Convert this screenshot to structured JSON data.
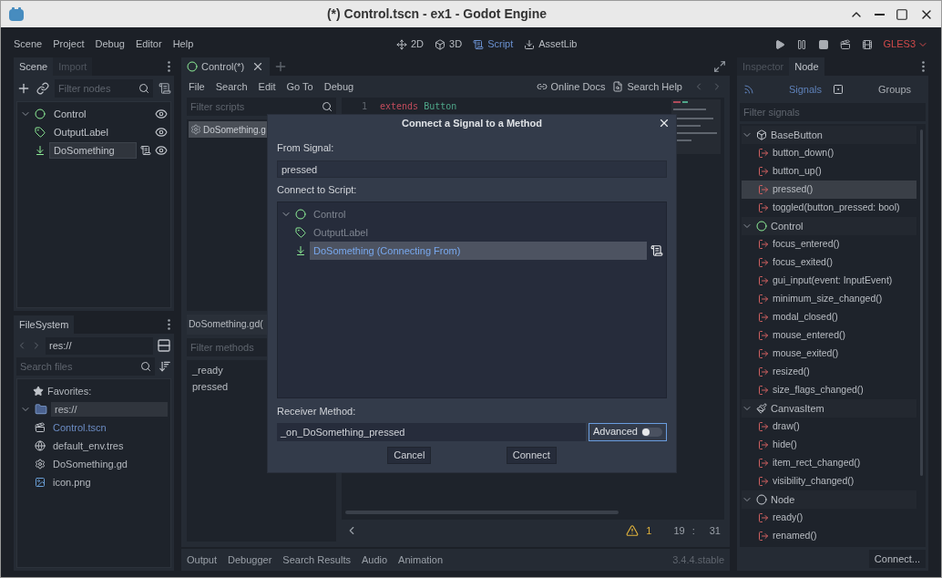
{
  "window": {
    "title": "(*) Control.tscn - ex1 - Godot Engine"
  },
  "menu": [
    "Scene",
    "Project",
    "Debug",
    "Editor",
    "Help"
  ],
  "workspaces": [
    {
      "label": "2D",
      "kind": "flat",
      "selected": false
    },
    {
      "label": "3D",
      "kind": "spatial",
      "selected": false
    },
    {
      "label": "Script",
      "kind": "script",
      "selected": true
    },
    {
      "label": "AssetLib",
      "kind": "assetlib",
      "selected": false
    }
  ],
  "renderer": "GLES3",
  "scene_dock": {
    "tabs": [
      {
        "label": "Scene",
        "selected": true
      },
      {
        "label": "Import",
        "selected": false
      }
    ],
    "filter_placeholder": "Filter nodes",
    "tree": [
      {
        "name": "Control",
        "kind": "control",
        "selected": false,
        "script": false,
        "children": [
          {
            "name": "OutputLabel",
            "kind": "label",
            "selected": false,
            "script": false
          },
          {
            "name": "DoSomething",
            "kind": "button",
            "selected": true,
            "script": true
          }
        ]
      }
    ]
  },
  "filesystem": {
    "tab": "FileSystem",
    "path": "res://",
    "search_placeholder": "Search files",
    "favorites": "Favorites:",
    "tree": [
      {
        "name": "res://",
        "kind": "folder",
        "selected": true,
        "children": [
          {
            "name": "Control.tscn",
            "kind": "scene",
            "selected": false
          },
          {
            "name": "default_env.tres",
            "kind": "environment",
            "selected": false
          },
          {
            "name": "DoSomething.gd",
            "kind": "script",
            "selected": false
          },
          {
            "name": "icon.png",
            "kind": "image",
            "selected": false
          }
        ]
      }
    ]
  },
  "script_editor": {
    "tab": "Control(*)",
    "menu": [
      "File",
      "Search",
      "Edit",
      "Go To",
      "Debug"
    ],
    "online_docs": "Online Docs",
    "search_help": "Search Help",
    "filter_scripts_placeholder": "Filter scripts",
    "scripts": [
      {
        "name": "DoSomething.g",
        "selected": true
      }
    ],
    "methods_title": "DoSomething.gd(",
    "filter_methods_placeholder": "Filter methods",
    "methods": [
      "_ready",
      "pressed"
    ],
    "code": [
      {
        "line": "1",
        "keyword": "extends",
        "type": "Button"
      }
    ],
    "warnings": "1",
    "cursor_line": "19",
    "cursor_sep": ":",
    "cursor_col": "31"
  },
  "bottom_panel": {
    "tabs": [
      "Output",
      "Debugger",
      "Search Results",
      "Audio",
      "Animation"
    ],
    "version": "3.4.4.stable"
  },
  "node_dock": {
    "tabs": [
      {
        "label": "Inspector",
        "selected": false
      },
      {
        "label": "Node",
        "selected": true
      }
    ],
    "subtabs": [
      {
        "label": "Signals",
        "kind": "signals",
        "selected": true
      },
      {
        "label": "Groups",
        "kind": "groups",
        "selected": false
      }
    ],
    "filter_placeholder": "Filter signals",
    "groups": [
      {
        "name": "BaseButton",
        "kind": "box",
        "signals": [
          {
            "name": "button_down()",
            "selected": false
          },
          {
            "name": "button_up()",
            "selected": false
          },
          {
            "name": "pressed()",
            "selected": true
          },
          {
            "name": "toggled(button_pressed: bool)",
            "selected": false
          }
        ]
      },
      {
        "name": "Control",
        "kind": "control",
        "signals": [
          {
            "name": "focus_entered()",
            "selected": false
          },
          {
            "name": "focus_exited()",
            "selected": false
          },
          {
            "name": "gui_input(event: InputEvent)",
            "selected": false
          },
          {
            "name": "minimum_size_changed()",
            "selected": false
          },
          {
            "name": "modal_closed()",
            "selected": false
          },
          {
            "name": "mouse_entered()",
            "selected": false
          },
          {
            "name": "mouse_exited()",
            "selected": false
          },
          {
            "name": "resized()",
            "selected": false
          },
          {
            "name": "size_flags_changed()",
            "selected": false
          }
        ]
      },
      {
        "name": "CanvasItem",
        "kind": "brush",
        "signals": [
          {
            "name": "draw()",
            "selected": false
          },
          {
            "name": "hide()",
            "selected": false
          },
          {
            "name": "item_rect_changed()",
            "selected": false
          },
          {
            "name": "visibility_changed()",
            "selected": false
          }
        ]
      },
      {
        "name": "Node",
        "kind": "node",
        "signals": [
          {
            "name": "ready()",
            "selected": false
          },
          {
            "name": "renamed()",
            "selected": false
          }
        ]
      }
    ],
    "connect_button": "Connect..."
  },
  "dialog": {
    "title": "Connect a Signal to a Method",
    "from_signal_label": "From Signal:",
    "from_signal": "pressed",
    "connect_to_label": "Connect to Script:",
    "tree": [
      {
        "name": "Control",
        "kind": "control",
        "selected": false,
        "disabled": true,
        "script": false,
        "children": [
          {
            "name": "OutputLabel",
            "kind": "label",
            "selected": false,
            "disabled": true,
            "script": false
          },
          {
            "name": "DoSomething (Connecting From)",
            "kind": "button",
            "selected": true,
            "disabled": false,
            "script": true
          }
        ]
      }
    ],
    "receiver_label": "Receiver Method:",
    "receiver_method": "_on_DoSomething_pressed",
    "advanced": {
      "label": "Advanced",
      "on": false
    },
    "buttons": [
      "Cancel",
      "Connect"
    ]
  }
}
